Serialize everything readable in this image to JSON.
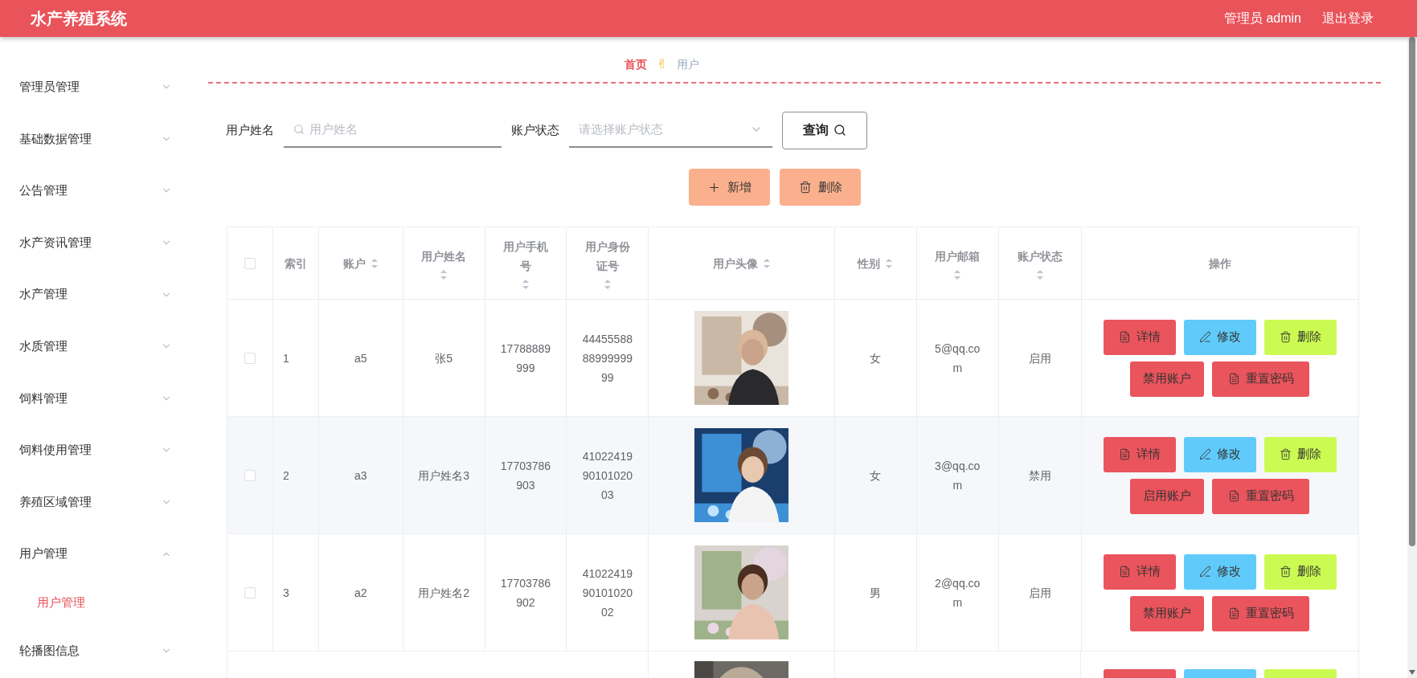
{
  "app": {
    "title": "水产养殖系统",
    "user": "管理员 admin",
    "logout": "退出登录"
  },
  "sidebar": {
    "items": [
      {
        "label": "管理员管理",
        "expanded": false
      },
      {
        "label": "基础数据管理",
        "expanded": false
      },
      {
        "label": "公告管理",
        "expanded": false
      },
      {
        "label": "水产资讯管理",
        "expanded": false
      },
      {
        "label": "水产管理",
        "expanded": false
      },
      {
        "label": "水质管理",
        "expanded": false
      },
      {
        "label": "饲料管理",
        "expanded": false
      },
      {
        "label": "饲料使用管理",
        "expanded": false
      },
      {
        "label": "养殖区域管理",
        "expanded": false
      },
      {
        "label": "用户管理",
        "expanded": true,
        "children": [
          {
            "label": "用户管理",
            "selected": true
          }
        ]
      },
      {
        "label": "轮播图信息",
        "expanded": false
      }
    ]
  },
  "breadcrumb": {
    "home": "首页",
    "separator": "✌",
    "current": "用户"
  },
  "search": {
    "fields": [
      {
        "kind": "text",
        "label": "用户姓名",
        "placeholder": "用户姓名"
      },
      {
        "kind": "select",
        "label": "账户状态",
        "placeholder": "请选择账户状态"
      }
    ],
    "button": "查询"
  },
  "toolbar": [
    {
      "kind": "add",
      "label": "新增"
    },
    {
      "kind": "delete",
      "label": "删除"
    }
  ],
  "table": {
    "all_checked": false,
    "columns": [
      {
        "label": "索引",
        "sortable": false
      },
      {
        "label": "账户",
        "sortable": true
      },
      {
        "label": "用户姓名",
        "sortable": true
      },
      {
        "label": "用户手机号",
        "sortable": true
      },
      {
        "label": "用户身份证号",
        "sortable": true
      },
      {
        "label": "用户头像",
        "sortable": true
      },
      {
        "label": "性别",
        "sortable": true
      },
      {
        "label": "用户邮箱",
        "sortable": true
      },
      {
        "label": "账户状态",
        "sortable": true
      },
      {
        "label": "操作",
        "sortable": false
      }
    ],
    "rows": [
      {
        "checked": false,
        "index": "1",
        "account": "a5",
        "name": "张5",
        "phone": "17788889999",
        "id_number": "444555888899999999",
        "gender": "女",
        "email": "5@qq.com",
        "status": "启用",
        "actions": [
          {
            "kind": "detail",
            "label": "详情"
          },
          {
            "kind": "edit",
            "label": "修改"
          },
          {
            "kind": "delete",
            "label": "删除"
          },
          {
            "kind": "toggle",
            "label": "禁用账户"
          },
          {
            "kind": "reset",
            "label": "重置密码"
          }
        ]
      },
      {
        "checked": false,
        "index": "2",
        "account": "a3",
        "name": "用户姓名3",
        "phone": "17703786903",
        "id_number": "410224199010102003",
        "gender": "女",
        "email": "3@qq.com",
        "status": "禁用",
        "actions": [
          {
            "kind": "detail",
            "label": "详情"
          },
          {
            "kind": "edit",
            "label": "修改"
          },
          {
            "kind": "delete",
            "label": "删除"
          },
          {
            "kind": "toggle",
            "label": "启用账户"
          },
          {
            "kind": "reset",
            "label": "重置密码"
          }
        ]
      },
      {
        "checked": false,
        "index": "3",
        "account": "a2",
        "name": "用户姓名2",
        "phone": "17703786902",
        "id_number": "410224199010102002",
        "gender": "男",
        "email": "2@qq.com",
        "status": "启用",
        "actions": [
          {
            "kind": "detail",
            "label": "详情"
          },
          {
            "kind": "edit",
            "label": "修改"
          },
          {
            "kind": "delete",
            "label": "删除"
          },
          {
            "kind": "toggle",
            "label": "禁用账户"
          },
          {
            "kind": "reset",
            "label": "重置密码"
          }
        ]
      }
    ]
  }
}
